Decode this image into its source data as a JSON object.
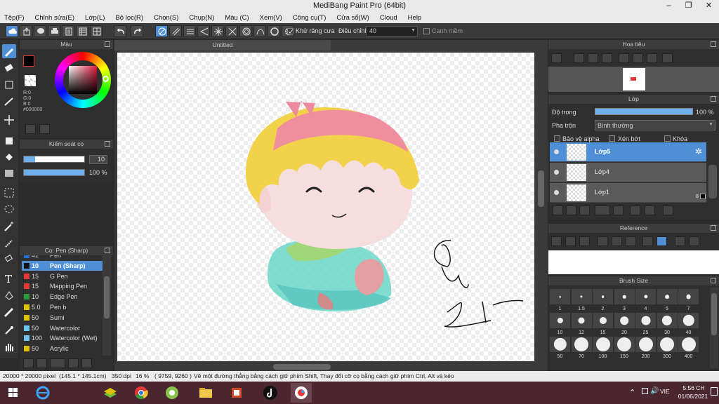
{
  "window": {
    "title": "MediBang Paint Pro (64bit)",
    "minimize": "–",
    "maximize": "❐",
    "close": "✕"
  },
  "menu": [
    "Tệp(F)",
    "Chỉnh sửa(E)",
    "Lớp(L)",
    "Bộ lọc(R)",
    "Chọn(S)",
    "Chụp(N)",
    "Màu (C)",
    "Xem(V)",
    "Công cụ(T)",
    "Cửa sổ(W)",
    "Cloud",
    "Help"
  ],
  "toolbar": {
    "antialias_label": "Khử răng cưa",
    "correction_label": "Điều chỉnh",
    "correction_value": "40",
    "margin_label": "Canh mềm"
  },
  "color_panel": {
    "title": "Màu",
    "r": "R:0",
    "g": "G:0",
    "b": "B:0",
    "hex": "#000000"
  },
  "brush_control": {
    "title": "Kiểm soát cọ",
    "size": "10",
    "opacity": "100 %"
  },
  "brush_panel": {
    "title": "Cọ: Pen (Sharp)",
    "items": [
      {
        "size": "41",
        "name": "Pen",
        "color": "#2a6fd0"
      },
      {
        "size": "10",
        "name": "Pen (Sharp)",
        "color": "#111111"
      },
      {
        "size": "15",
        "name": "G Pen",
        "color": "#e53935"
      },
      {
        "size": "15",
        "name": "Mapping Pen",
        "color": "#e53935"
      },
      {
        "size": "10",
        "name": "Edge Pen",
        "color": "#2e9b3a"
      },
      {
        "size": "5.0",
        "name": "Pen b",
        "color": "#e0c000"
      },
      {
        "size": "50",
        "name": "Sumi",
        "color": "#e0c000"
      },
      {
        "size": "50",
        "name": "Watercolor",
        "color": "#6ec6f0"
      },
      {
        "size": "100",
        "name": "Watercolor (Wet)",
        "color": "#6ec6f0"
      },
      {
        "size": "50",
        "name": "Acrylic",
        "color": "#e0c000"
      }
    ]
  },
  "canvas": {
    "tab": "Untitled"
  },
  "navigator": {
    "title": "Hoa tiêu"
  },
  "layer_panel": {
    "title": "Lớp",
    "opacity_label": "Độ trong",
    "opacity_value": "100 %",
    "blend_label": "Pha trộn",
    "blend_value": "Bình thường",
    "protect_alpha": "Bảo vệ alpha",
    "clipping": "Xén bớt",
    "lock": "Khóa",
    "layers": [
      {
        "name": "Lớp5"
      },
      {
        "name": "Lớp4"
      },
      {
        "name": "Lớp1",
        "badge": "8"
      }
    ]
  },
  "reference": {
    "title": "Reference"
  },
  "brush_size": {
    "title": "Brush Size",
    "sizes": [
      "1",
      "1.5",
      "2",
      "3",
      "4",
      "5",
      "7",
      "10",
      "12",
      "15",
      "20",
      "25",
      "30",
      "40",
      "50",
      "70",
      "100",
      "150",
      "200",
      "300",
      "400"
    ]
  },
  "status": {
    "dims": "20000 * 20000 pixel",
    "cm": "(145.1 * 145.1cm)",
    "dpi": "350 dpi",
    "zoom": "16 %",
    "coords": "( 9759, 9260 )",
    "hint": "Vẽ một đường thẳng bằng cách giữ phím Shift, Thay đổi cỡ cọ bằng cách giữ phím Ctrl, Alt và kéo"
  },
  "taskbar": {
    "lang": "VIE",
    "time": "5:56 CH",
    "date": "01/06/2021"
  },
  "colors": {
    "accent": "#4f8fd6",
    "skin": "#f7dede",
    "hair_yellow": "#f2d24a",
    "hair_pink": "#ee8aa0",
    "shirt": "#6fd2c4"
  }
}
